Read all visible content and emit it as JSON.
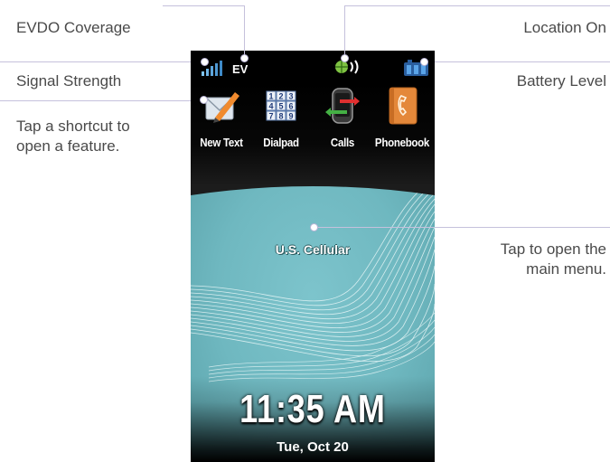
{
  "callouts": {
    "evdo": "EVDO Coverage",
    "signal": "Signal Strength",
    "shortcut_line1": "Tap a shortcut to",
    "shortcut_line2": "open a feature.",
    "location": "Location On",
    "battery": "Battery Level",
    "menu_line1": "Tap to open the",
    "menu_line2": "main menu."
  },
  "status_bar": {
    "evdo_indicator": "EV",
    "icons": [
      "signal-strength-icon",
      "location-on-icon",
      "battery-level-icon"
    ]
  },
  "shortcuts": [
    {
      "label": "New Text",
      "icon": "new-text-icon"
    },
    {
      "label": "Dialpad",
      "icon": "dialpad-icon"
    },
    {
      "label": "Calls",
      "icon": "calls-icon"
    },
    {
      "label": "Phonebook",
      "icon": "phonebook-icon"
    }
  ],
  "dialpad_digits": [
    "1",
    "2",
    "3",
    "4",
    "5",
    "6",
    "7",
    "8",
    "9"
  ],
  "home": {
    "carrier": "U.S. Cellular",
    "time": "11:35 AM",
    "date": "Tue, Oct 20"
  },
  "colors": {
    "wallpaper": "#6fb8c0",
    "leader_lines": "#c5c1dc",
    "callout_text": "#4a4a4a"
  }
}
